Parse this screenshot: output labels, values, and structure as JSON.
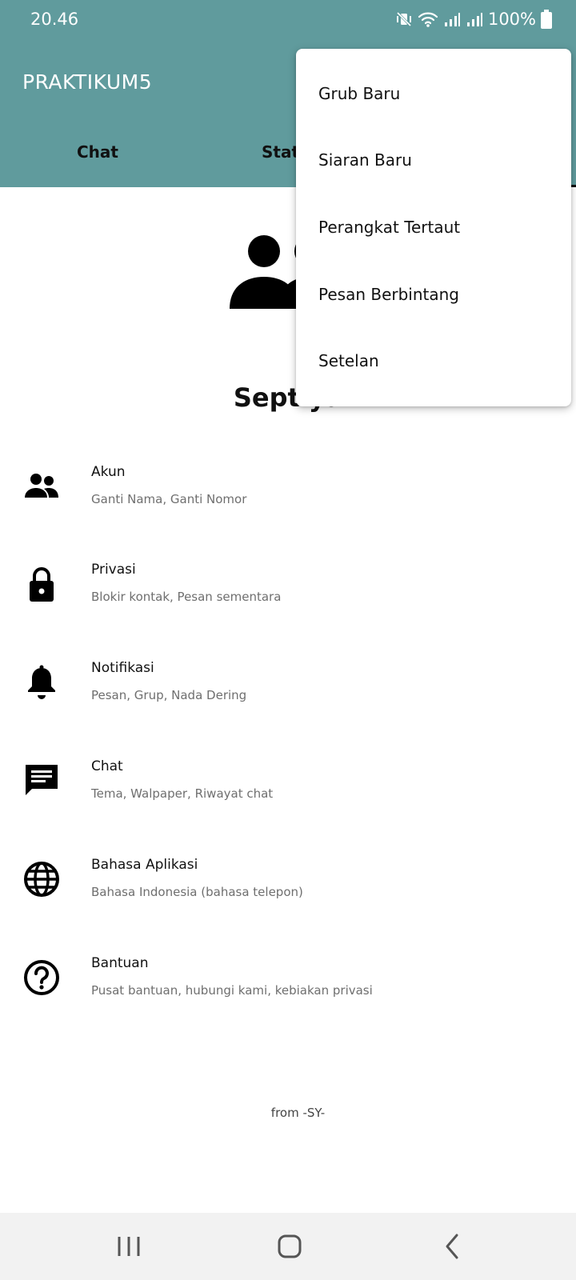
{
  "status_bar": {
    "time": "20.46",
    "battery_text": "100%",
    "icons": [
      "mute-vibrate-icon",
      "wifi-icon",
      "signal-icon",
      "signal-icon",
      "battery-icon"
    ]
  },
  "app_bar": {
    "title": "PRAKTIKUM5"
  },
  "tabs": [
    {
      "label": "Chat"
    },
    {
      "label": "Status"
    }
  ],
  "profile": {
    "name": "Septiya"
  },
  "settings": [
    {
      "icon": "account-icon",
      "title": "Akun",
      "subtitle": "Ganti Nama, Ganti Nomor"
    },
    {
      "icon": "lock-icon",
      "title": "Privasi",
      "subtitle": "Blokir kontak, Pesan sementara"
    },
    {
      "icon": "bell-icon",
      "title": "Notifikasi",
      "subtitle": "Pesan, Grup, Nada Dering"
    },
    {
      "icon": "chat-icon",
      "title": "Chat",
      "subtitle": "Tema, Walpaper, Riwayat chat"
    },
    {
      "icon": "globe-icon",
      "title": "Bahasa Aplikasi",
      "subtitle": "Bahasa Indonesia (bahasa telepon)"
    },
    {
      "icon": "help-icon",
      "title": "Bantuan",
      "subtitle": "Pusat bantuan, hubungi kami, kebiakan privasi"
    }
  ],
  "footer": {
    "text": "from -SY-"
  },
  "overflow_menu": {
    "items": [
      {
        "label": "Grub Baru"
      },
      {
        "label": "Siaran Baru"
      },
      {
        "label": "Perangkat Tertaut"
      },
      {
        "label": "Pesan Berbintang"
      },
      {
        "label": "Setelan"
      }
    ]
  },
  "nav_bar": {
    "buttons": [
      "recents-icon",
      "home-icon",
      "back-icon"
    ]
  },
  "colors": {
    "primary": "#609b9d",
    "tab_indicator": "#111111",
    "menu_bg": "#ffffff"
  }
}
